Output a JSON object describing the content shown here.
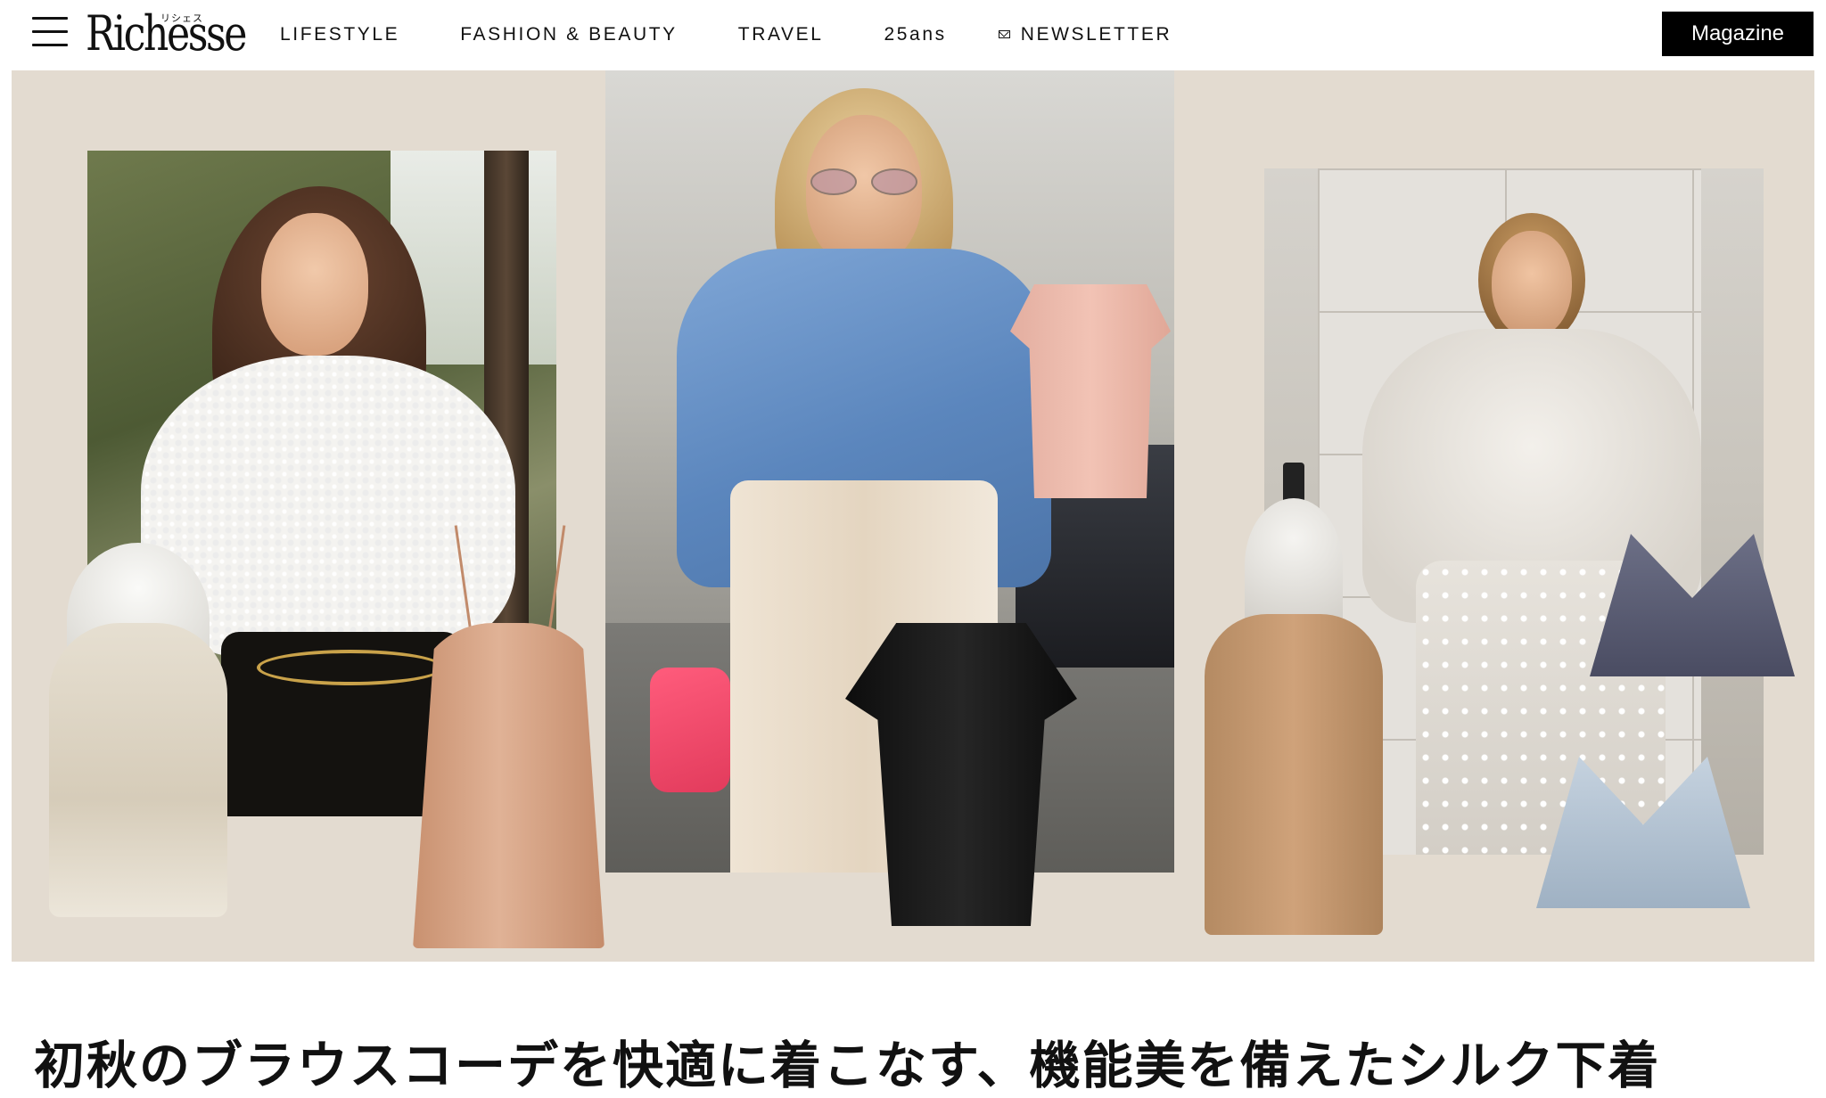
{
  "header": {
    "logo": {
      "text": "Richesse",
      "kana": "リシェス"
    },
    "nav": [
      {
        "label": "LIFESTYLE"
      },
      {
        "label": "FASHION & BEAUTY"
      },
      {
        "label": "TRAVEL"
      },
      {
        "label": "25ans"
      },
      {
        "label": "NEWSLETTER",
        "icon": "mail-icon"
      }
    ],
    "magazine_button": "Magazine"
  },
  "hero": {
    "background_color": "#e3dbd0",
    "items": [
      {
        "kind": "photo",
        "subject": "woman in white lace top"
      },
      {
        "kind": "photo",
        "subject": "woman in blue top and cream trousers"
      },
      {
        "kind": "photo",
        "subject": "woman in white blouse and skirt"
      },
      {
        "kind": "product",
        "item": "ivory camisole on mannequin"
      },
      {
        "kind": "product",
        "item": "peach silk slip"
      },
      {
        "kind": "product",
        "item": "pink short sleeve top"
      },
      {
        "kind": "product",
        "item": "black short sleeve top"
      },
      {
        "kind": "product",
        "item": "camel camisole on mannequin"
      },
      {
        "kind": "product",
        "item": "navy silk bra"
      },
      {
        "kind": "product",
        "item": "light blue silk bra"
      }
    ]
  },
  "article": {
    "title": "初秋のブラウスコーデを快適に着こなす、機能美を備えたシルク下着"
  }
}
